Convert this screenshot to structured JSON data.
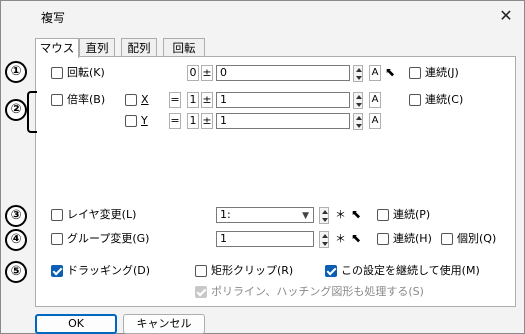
{
  "window": {
    "title": "複写",
    "close_glyph": "✕"
  },
  "tabs": [
    {
      "label": "マウス",
      "active": true
    },
    {
      "label": "直列",
      "active": false
    },
    {
      "label": "配列",
      "active": false
    },
    {
      "label": "回転",
      "active": false
    }
  ],
  "markers": [
    "①",
    "②",
    "③",
    "④",
    "⑤"
  ],
  "rotate": {
    "label": "回転(K)",
    "checked": false,
    "field_a": "0",
    "plusminus": "±",
    "value": "0",
    "glyph_a": "A",
    "continuous_label": "連続(J)"
  },
  "scale": {
    "label": "倍率(B)",
    "checked": false,
    "continuous_label": "連続(C)",
    "x": {
      "label": "X",
      "eq": "=",
      "one": "1",
      "plusminus": "±",
      "value": "1",
      "glyph_a": "A"
    },
    "y": {
      "label": "Y",
      "eq": "=",
      "one": "1",
      "plusminus": "±",
      "value": "1",
      "glyph_a": "A"
    }
  },
  "layer": {
    "label": "レイヤ変更(L)",
    "checked": false,
    "value": "1:",
    "star": "＊",
    "continuous_label": "連続(P)"
  },
  "group": {
    "label": "グループ変更(G)",
    "checked": false,
    "value": "1",
    "star": "＊",
    "continuous_label": "連続(H)",
    "individual_label": "個別(Q)"
  },
  "drag": {
    "label": "ドラッギング(D)",
    "checked": true,
    "rect_clip_label": "矩形クリップ(R)",
    "continue_label": "この設定を継続して使用(M)",
    "polyline_label": "ポリライン、ハッチング図形も処理する(S)"
  },
  "buttons": {
    "ok": "OK",
    "cancel": "キャンセル"
  },
  "colors": {
    "accent": "#0067c0",
    "check": "#0a5fb4"
  }
}
